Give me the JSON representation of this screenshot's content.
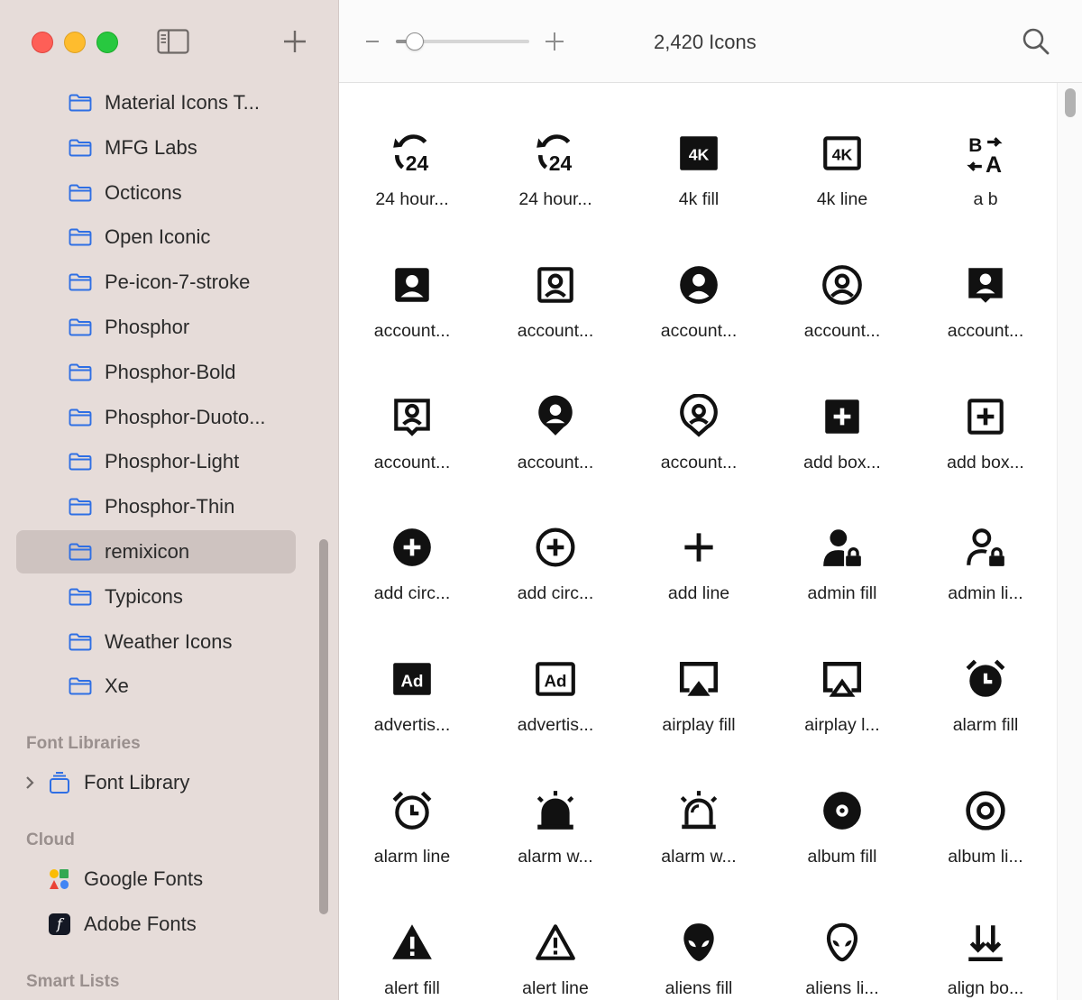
{
  "window": {
    "controls": [
      "close",
      "minimize",
      "zoom"
    ]
  },
  "sidebar": {
    "collections": [
      {
        "label": "Material Icons T...",
        "icon": "folder-icon"
      },
      {
        "label": "MFG Labs",
        "icon": "folder-icon"
      },
      {
        "label": "Octicons",
        "icon": "folder-icon"
      },
      {
        "label": "Open Iconic",
        "icon": "folder-icon"
      },
      {
        "label": "Pe-icon-7-stroke",
        "icon": "folder-icon"
      },
      {
        "label": "Phosphor",
        "icon": "folder-icon"
      },
      {
        "label": "Phosphor-Bold",
        "icon": "folder-icon"
      },
      {
        "label": "Phosphor-Duoto...",
        "icon": "folder-icon"
      },
      {
        "label": "Phosphor-Light",
        "icon": "folder-icon"
      },
      {
        "label": "Phosphor-Thin",
        "icon": "folder-icon"
      },
      {
        "label": "remixicon",
        "icon": "folder-icon",
        "selected": true
      },
      {
        "label": "Typicons",
        "icon": "folder-icon"
      },
      {
        "label": "Weather Icons",
        "icon": "folder-icon"
      },
      {
        "label": "Xe",
        "icon": "folder-icon"
      }
    ],
    "font_libraries": {
      "heading": "Font Libraries",
      "item": "Font Library"
    },
    "cloud": {
      "heading": "Cloud",
      "items": [
        "Google Fonts",
        "Adobe Fonts"
      ]
    },
    "smart_lists": {
      "heading": "Smart Lists"
    }
  },
  "toolbar": {
    "count": "2,420 Icons",
    "zoom_level": 0.15
  },
  "icons": [
    {
      "name": "24 hour...",
      "icon": "24-hours-fill-icon"
    },
    {
      "name": "24 hour...",
      "icon": "24-hours-line-icon"
    },
    {
      "name": "4k fill",
      "icon": "4k-fill-icon"
    },
    {
      "name": "4k line",
      "icon": "4k-line-icon"
    },
    {
      "name": "a b",
      "icon": "a-b-icon"
    },
    {
      "name": "account...",
      "icon": "account-box-fill-icon"
    },
    {
      "name": "account...",
      "icon": "account-box-line-icon"
    },
    {
      "name": "account...",
      "icon": "account-circle-fill-icon"
    },
    {
      "name": "account...",
      "icon": "account-circle-line-icon"
    },
    {
      "name": "account...",
      "icon": "account-pin-box-fill-icon"
    },
    {
      "name": "account...",
      "icon": "account-pin-box-line-icon"
    },
    {
      "name": "account...",
      "icon": "account-pin-circle-fill-icon"
    },
    {
      "name": "account...",
      "icon": "account-pin-circle-line-icon"
    },
    {
      "name": "add box...",
      "icon": "add-box-fill-icon"
    },
    {
      "name": "add box...",
      "icon": "add-box-line-icon"
    },
    {
      "name": "add circ...",
      "icon": "add-circle-fill-icon"
    },
    {
      "name": "add circ...",
      "icon": "add-circle-line-icon"
    },
    {
      "name": "add line",
      "icon": "add-line-icon"
    },
    {
      "name": "admin fill",
      "icon": "admin-fill-icon"
    },
    {
      "name": "admin li...",
      "icon": "admin-line-icon"
    },
    {
      "name": "advertis...",
      "icon": "advertisement-fill-icon"
    },
    {
      "name": "advertis...",
      "icon": "advertisement-line-icon"
    },
    {
      "name": "airplay fill",
      "icon": "airplay-fill-icon"
    },
    {
      "name": "airplay l...",
      "icon": "airplay-line-icon"
    },
    {
      "name": "alarm fill",
      "icon": "alarm-fill-icon"
    },
    {
      "name": "alarm line",
      "icon": "alarm-line-icon"
    },
    {
      "name": "alarm w...",
      "icon": "alarm-warning-fill-icon"
    },
    {
      "name": "alarm w...",
      "icon": "alarm-warning-line-icon"
    },
    {
      "name": "album fill",
      "icon": "album-fill-icon"
    },
    {
      "name": "album li...",
      "icon": "album-line-icon"
    },
    {
      "name": "alert fill",
      "icon": "alert-fill-icon"
    },
    {
      "name": "alert line",
      "icon": "alert-line-icon"
    },
    {
      "name": "aliens fill",
      "icon": "aliens-fill-icon"
    },
    {
      "name": "aliens li...",
      "icon": "aliens-line-icon"
    },
    {
      "name": "align bo...",
      "icon": "align-bottom-icon"
    }
  ]
}
